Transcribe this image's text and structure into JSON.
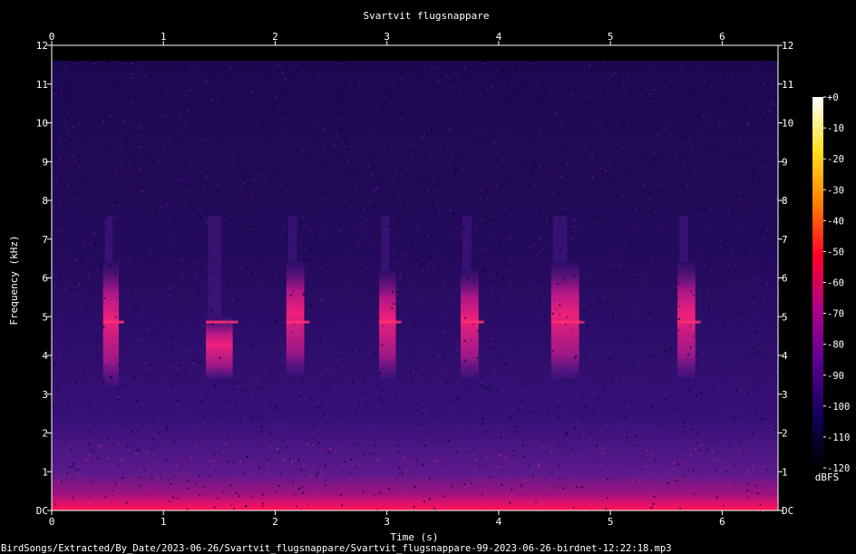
{
  "chart_data": {
    "type": "heatmap",
    "title": "Svartvit flugsnappare",
    "xlabel": "Time (s)",
    "ylabel": "Frequency (kHz)",
    "xlim": [
      0,
      6.5
    ],
    "ylim": [
      0,
      12
    ],
    "x_ticks": [
      "0",
      "1",
      "2",
      "3",
      "4",
      "5",
      "6"
    ],
    "y_ticks": [
      "DC",
      "1",
      "2",
      "3",
      "4",
      "5",
      "6",
      "7",
      "8",
      "9",
      "10",
      "11",
      "12"
    ],
    "colorbar": {
      "label": "dBFS",
      "ticks": [
        "+0",
        "-10",
        "-20",
        "-30",
        "-40",
        "-50",
        "-60",
        "-70",
        "-80",
        "-90",
        "-100",
        "-110",
        "-120"
      ],
      "range_db": [
        -120,
        0
      ],
      "colors": [
        "#000000",
        "#14005a",
        "#5a0090",
        "#b0008a",
        "#ff0028",
        "#ff8000",
        "#ffe020",
        "#ffffff"
      ]
    },
    "signal_upper_khz": 11.6,
    "calls": [
      {
        "t_start": 0.46,
        "t_end": 0.6,
        "f_low_khz": 3.2,
        "f_high_khz": 6.4
      },
      {
        "t_start": 1.38,
        "t_end": 1.62,
        "f_low_khz": 3.4,
        "f_high_khz": 5.0
      },
      {
        "t_start": 2.1,
        "t_end": 2.26,
        "f_low_khz": 3.5,
        "f_high_khz": 6.4
      },
      {
        "t_start": 2.93,
        "t_end": 3.08,
        "f_low_khz": 3.4,
        "f_high_khz": 6.2
      },
      {
        "t_start": 3.66,
        "t_end": 3.82,
        "f_low_khz": 3.4,
        "f_high_khz": 6.2
      },
      {
        "t_start": 4.47,
        "t_end": 4.72,
        "f_low_khz": 3.4,
        "f_high_khz": 6.4
      },
      {
        "t_start": 5.6,
        "t_end": 5.76,
        "f_low_khz": 3.4,
        "f_high_khz": 6.4
      }
    ]
  },
  "footer": {
    "file_path": "BirdSongs/Extracted/By_Date/2023-06-26/Svartvit_flugsnappare/Svartvit_flugsnappare-99-2023-06-26-birdnet-12:22:18.mp3"
  }
}
